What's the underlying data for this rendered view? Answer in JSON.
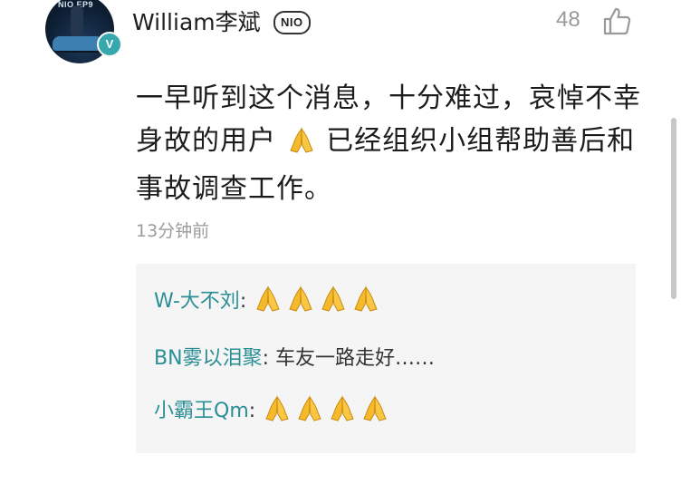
{
  "comment": {
    "username": "William李斌",
    "badge_text": "NIO",
    "avatar_brand": "NIO EP9",
    "verified_mark": "V",
    "like_count": "48",
    "body_part1": "一早听到这个消息，十分难过，哀悼不幸身故的用户",
    "body_part2": " 已经组织小组帮助善后和事故调查工作。",
    "timestamp": "13分钟前"
  },
  "replies": [
    {
      "name": "W-大不刘",
      "separator": ": ",
      "text": "",
      "emoji_count": 4
    },
    {
      "name": "BN雾以泪聚",
      "separator": ": ",
      "text": "车友一路走好……",
      "emoji_count": 0
    },
    {
      "name": "小霸王Qm",
      "separator": ": ",
      "text": "",
      "emoji_count": 4
    }
  ],
  "colors": {
    "reply_name": "#2a8f95",
    "verified_badge": "#36a8ae",
    "reply_background": "#f5f5f5",
    "muted_text": "#9b9b9b"
  },
  "icons": [
    "like-thumb-icon",
    "praying-hands-emoji",
    "verified-icon"
  ]
}
